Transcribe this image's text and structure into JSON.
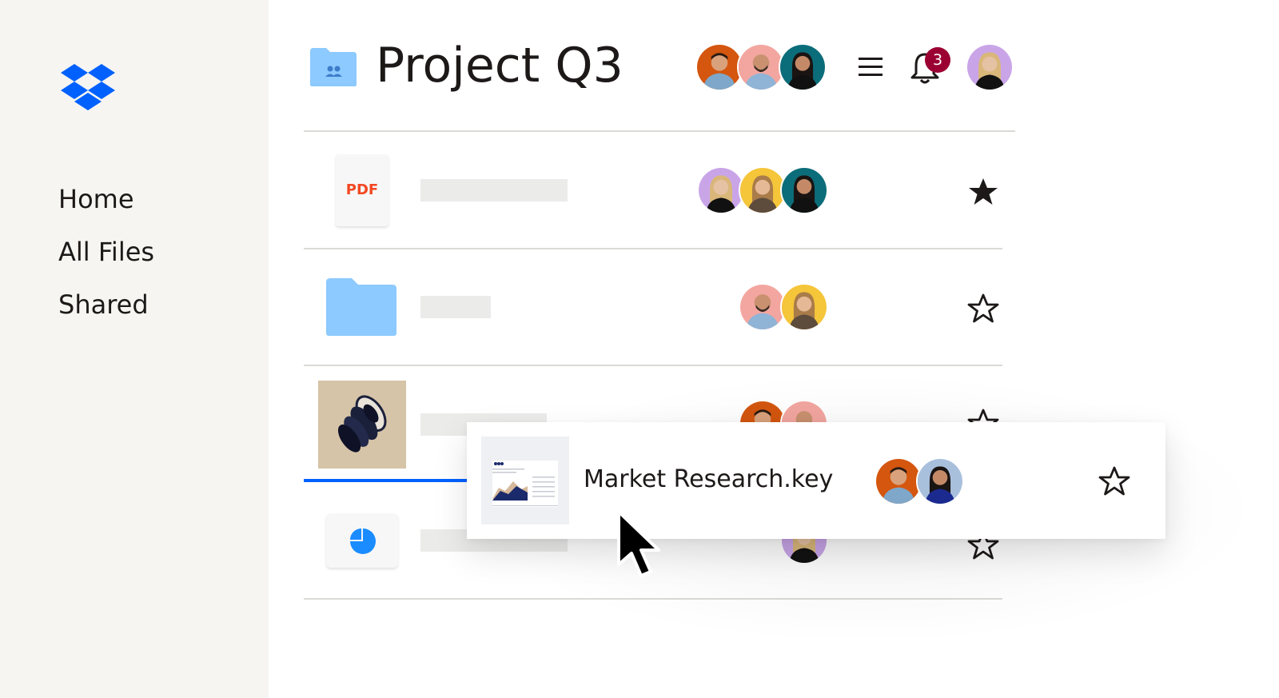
{
  "brand": {
    "logo_icon": "dropbox-logo-icon",
    "accent": "#0061fe"
  },
  "sidebar": {
    "items": [
      {
        "label": "Home"
      },
      {
        "label": "All Files"
      },
      {
        "label": "Shared"
      }
    ]
  },
  "header": {
    "folder_icon": "shared-folder-icon",
    "title": "Project Q3",
    "members": [
      "member-1",
      "member-2",
      "member-3"
    ],
    "menu_icon": "hamburger-menu-icon",
    "bell_icon": "notification-bell-icon",
    "notification_count": "3",
    "badge_color": "#9b0032"
  },
  "files": [
    {
      "type_label": "PDF",
      "icon": "pdf-file-icon",
      "starred": true
    },
    {
      "icon": "folder-icon",
      "starred": false
    },
    {
      "icon": "image-thumbnail",
      "starred": false
    },
    {
      "icon": "pie-chart-icon",
      "starred": false
    }
  ],
  "drag_card": {
    "name": "Market Research.key",
    "icon": "keynote-thumbnail",
    "starred": false
  },
  "colors": {
    "sidebar_bg": "#f6f5f2",
    "folder_blue": "#8ccaff",
    "pdf_red": "#f24822",
    "star_fill": "#1e1919"
  }
}
